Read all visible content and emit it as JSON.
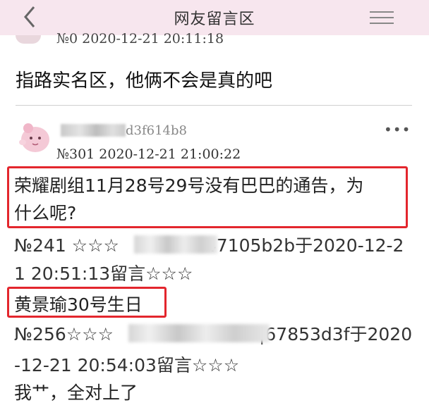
{
  "header": {
    "title": "网友留言区",
    "back_icon": "chevron-left-icon",
    "menu_icon": "hamburger-menu-icon",
    "background": "#f7e6ee"
  },
  "previous_post": {
    "meta": "№0   2020-12-21 20:11:18",
    "text": "指路实名区，他俩不会是真的吧"
  },
  "post": {
    "username_suffix": "d3f614b8",
    "more_label": "•••",
    "meta": "№301   2020-12-21 21:00:22",
    "lines": [
      "荣耀剧组11月28号29号没有巴巴的通告，为",
      "什么呢?"
    ],
    "quote1": {
      "prefix": "№241 ☆☆☆",
      "suffix": "47105b2b于2020-12-2",
      "line2": "1 20:51:13留言☆☆☆"
    },
    "highlight2": "黄景瑜30号生日",
    "quote2": {
      "prefix": "№256☆☆☆",
      "suffix": "|67853d3f于2020",
      "line2": "-12-21 20:54:03留言☆☆☆"
    },
    "reply": "我艹，全对上了"
  },
  "colors": {
    "highlight_border": "#e3262d",
    "divider": "#cfcfcf"
  }
}
